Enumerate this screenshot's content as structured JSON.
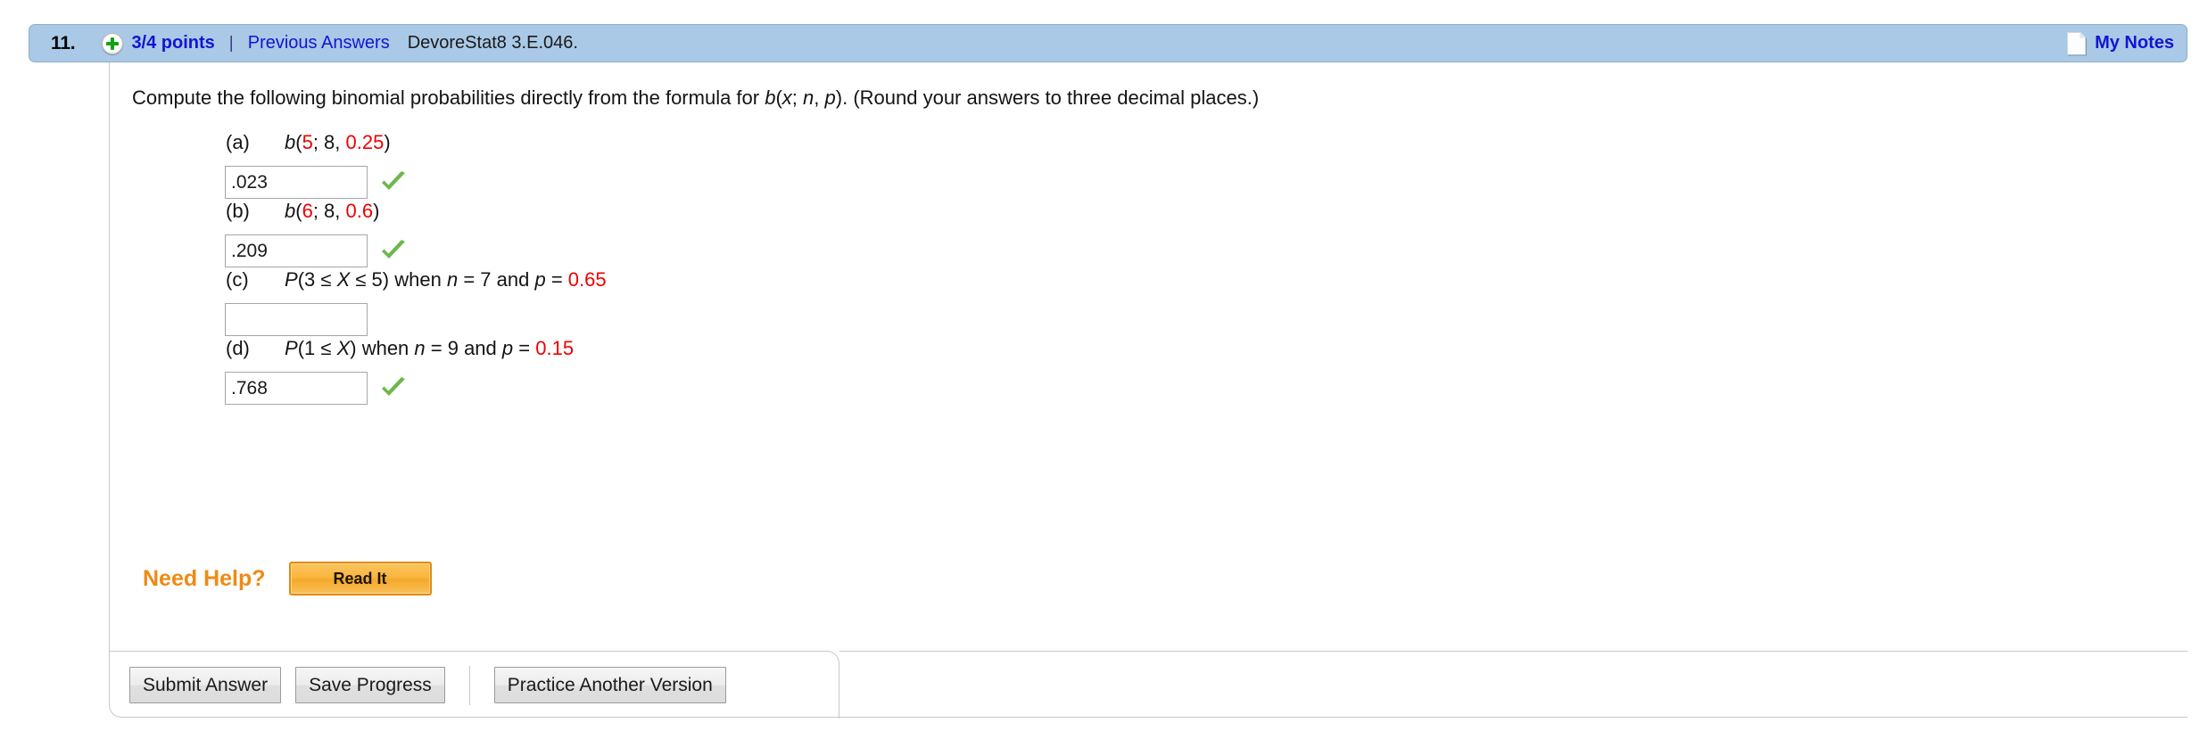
{
  "header": {
    "question_number": "11.",
    "status_icon": "plus-circle-icon",
    "points": "3/4 points",
    "separator": "|",
    "previous_answers_link": "Previous Answers",
    "textbook_reference": "DevoreStat8 3.E.046.",
    "notes_icon": "note-page-icon",
    "my_notes_label": "My Notes",
    "background_color": "#a9c9e6",
    "link_color": "#1414d2"
  },
  "prompt": {
    "text_1": "Compute the following binomial probabilities directly from the formula for ",
    "formula_b": "b",
    "formula_open": "(",
    "formula_x": "x",
    "formula_semi": "; ",
    "formula_n": "n",
    "formula_comma": ", ",
    "formula_p": "p",
    "formula_close": ")",
    "text_2": ". (Round your answers to three decimal places.)"
  },
  "parts": [
    {
      "letter": "(a)",
      "expr_fn": "b",
      "expr_open": "(",
      "expr_arg1": "5",
      "expr_mid": "; 8, ",
      "expr_arg2": "0.25",
      "expr_close": ")",
      "value": ".023",
      "placeholder": "",
      "correct": true,
      "check_icon": "green-check-icon"
    },
    {
      "letter": "(b)",
      "expr_fn": "b",
      "expr_open": "(",
      "expr_arg1": "6",
      "expr_mid": "; 8, ",
      "expr_arg2": "0.6",
      "expr_close": ")",
      "value": ".209",
      "placeholder": "",
      "correct": true,
      "check_icon": "green-check-icon"
    },
    {
      "letter": "(c)",
      "expr_fn": "P",
      "expr_open": "(3 ≤ ",
      "expr_var": "X",
      "expr_mid2": " ≤ 5)",
      "expr_when": "  when ",
      "expr_n_sym": "n",
      "expr_n_val": " = 7 and ",
      "expr_p_sym": "p",
      "expr_eq": " = ",
      "expr_p_val": "0.65",
      "value": "",
      "placeholder": "",
      "correct": false
    },
    {
      "letter": "(d)",
      "expr_fn": "P",
      "expr_open": "(1 ≤ ",
      "expr_var": "X",
      "expr_mid2": ")",
      "expr_when": "  when ",
      "expr_n_sym": "n",
      "expr_n_val": " = 9 and ",
      "expr_p_sym": "p",
      "expr_eq": " = ",
      "expr_p_val": "0.15",
      "value": ".768",
      "placeholder": "",
      "correct": true,
      "check_icon": "green-check-icon"
    }
  ],
  "need_help": {
    "label": "Need Help?",
    "read_it_label": "Read It",
    "accent_color": "#ef8a13"
  },
  "actions": {
    "submit_label": "Submit Answer",
    "save_label": "Save Progress",
    "practice_label": "Practice Another Version"
  },
  "colors": {
    "red_value": "#ee0000",
    "green_check": "#6bb84b",
    "orange": "#ef8a13"
  }
}
